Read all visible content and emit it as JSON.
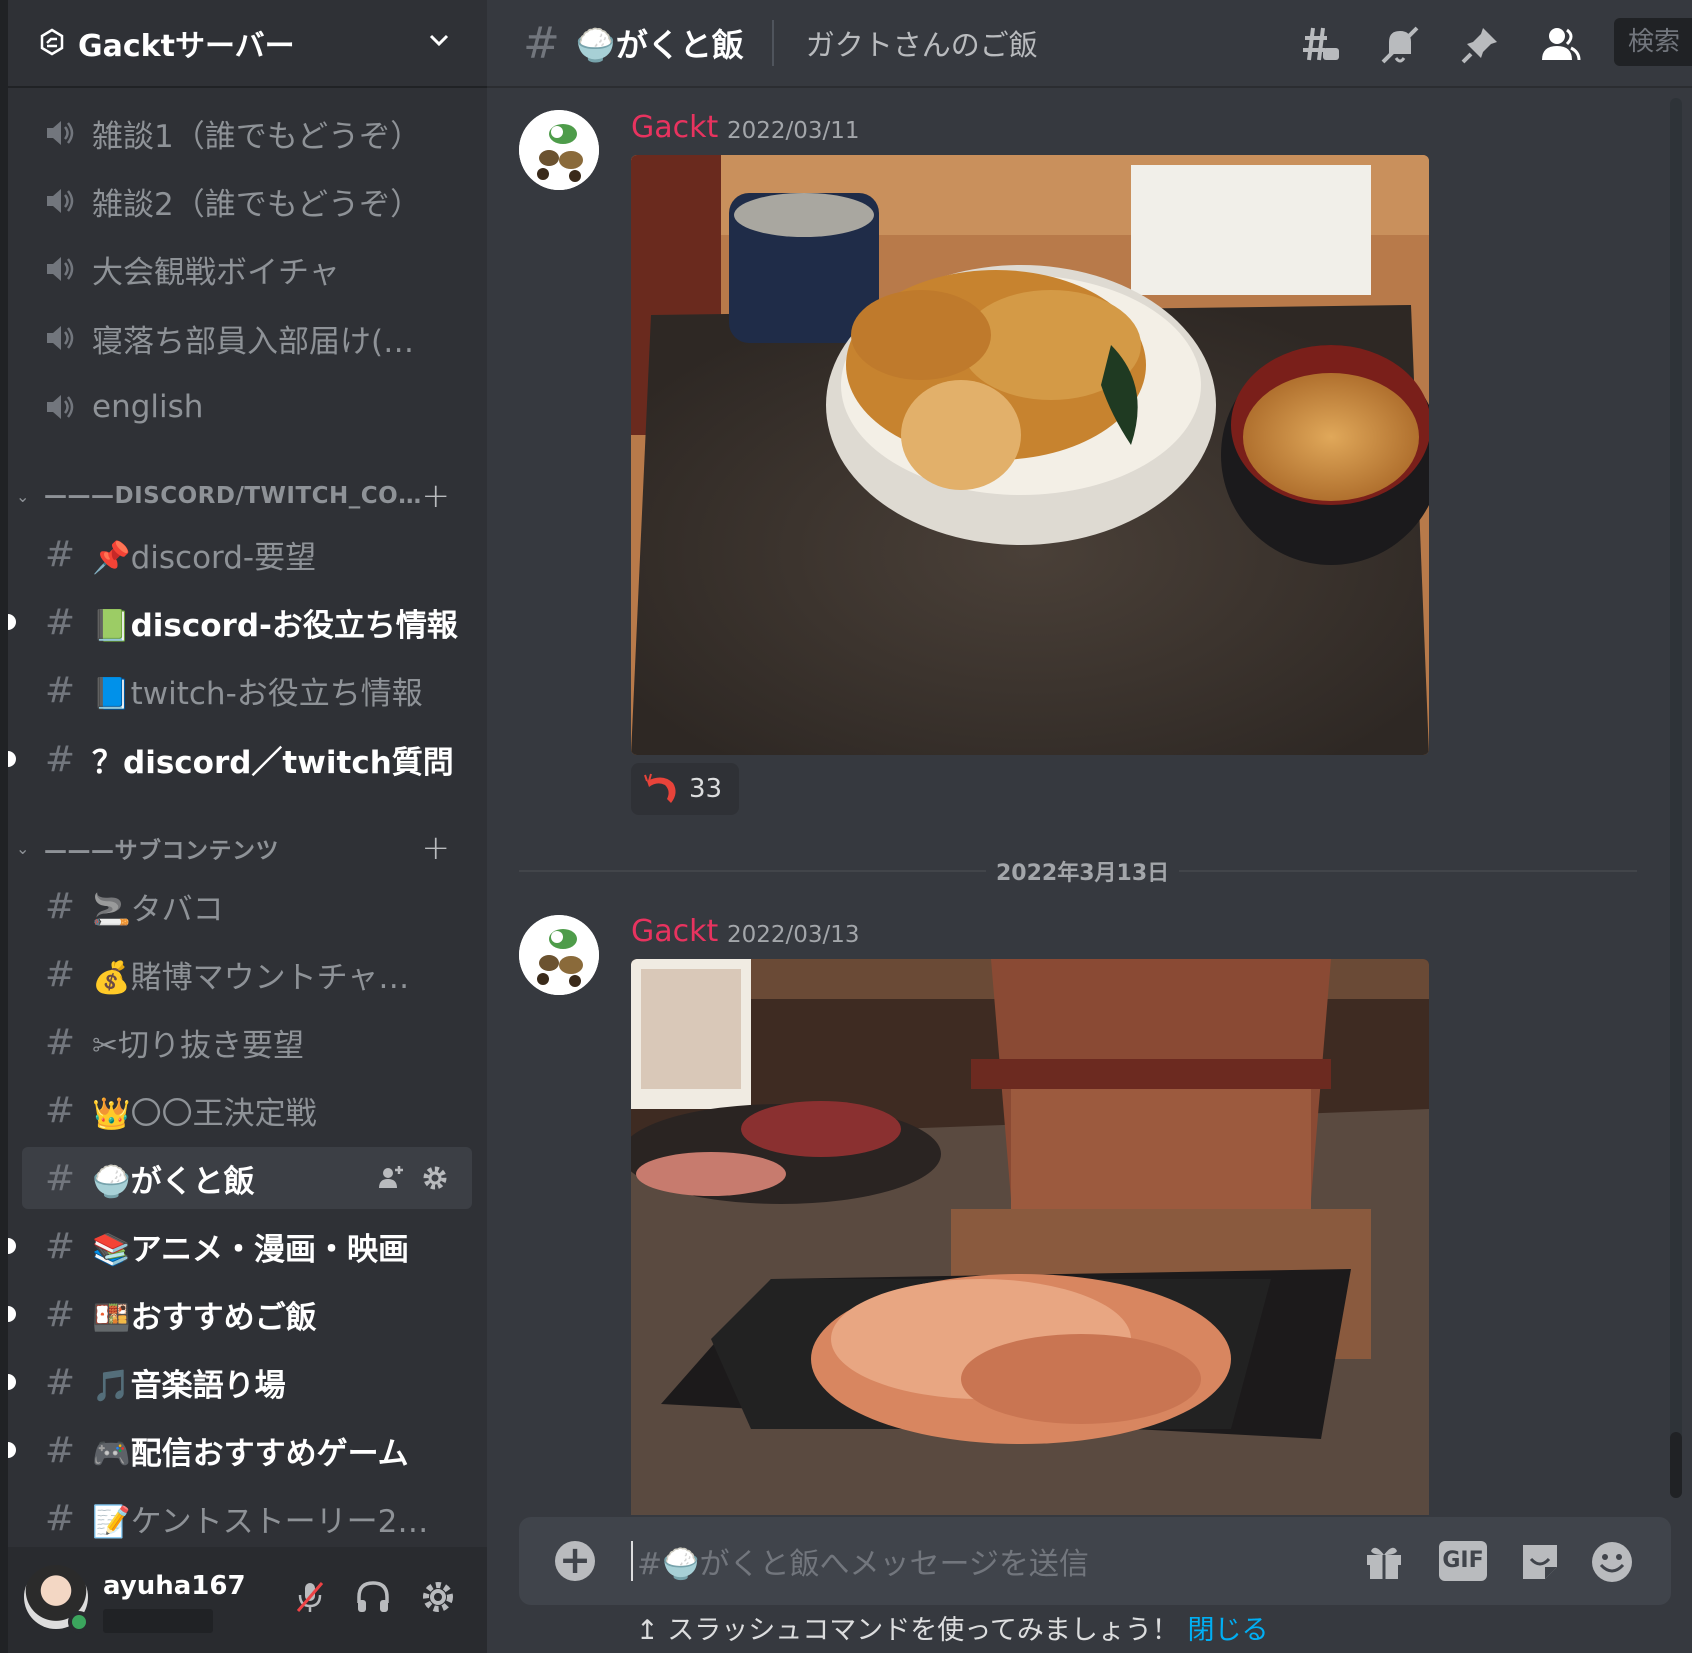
{
  "server": {
    "name": "Gacktサーバー"
  },
  "voice_channels": [
    {
      "name": "雑談1（誰でもどうぞ）"
    },
    {
      "name": "雑談2（誰でもどうぞ）"
    },
    {
      "name": "大会観戦ボイチャ"
    },
    {
      "name": "寝落ち部員入部届け(…"
    },
    {
      "name": "english"
    }
  ],
  "categories": [
    {
      "name": "———DISCORD/TWITCH_CO…",
      "channels": [
        {
          "name": "📌discord-要望",
          "unread": false
        },
        {
          "name": "📗discord-お役立ち情報",
          "unread": true
        },
        {
          "name": "📘twitch-お役立ち情報",
          "unread": false
        },
        {
          "name": "？discord／twitch質問",
          "unread": true
        }
      ]
    },
    {
      "name": "———サブコンテンツ",
      "channels": [
        {
          "name": "🚬タバコ",
          "unread": false
        },
        {
          "name": "💰賭博マウントチャ…",
          "unread": false
        },
        {
          "name": "✂切り抜き要望",
          "unread": false
        },
        {
          "name": "👑〇〇王決定戦",
          "unread": false
        },
        {
          "name": "🍚がくと飯",
          "unread": false,
          "active": true
        },
        {
          "name": "📚アニメ・漫画・映画",
          "unread": true
        },
        {
          "name": "🍱おすすめご飯",
          "unread": true
        },
        {
          "name": "🎵音楽語り場",
          "unread": true
        },
        {
          "name": "🎮配信おすすめゲーム",
          "unread": true
        },
        {
          "name": "📝ケントストーリー2…",
          "unread": false
        }
      ]
    }
  ],
  "user": {
    "name": "ayuha167"
  },
  "topbar": {
    "channel": "🍚がくと飯",
    "topic": "ガクトさんのご飯",
    "search": "検索"
  },
  "messages": [
    {
      "author": "Gackt",
      "timestamp": "2022/03/11",
      "reaction_count": "33"
    },
    {
      "author": "Gackt",
      "timestamp": "2022/03/13"
    }
  ],
  "date_divider": "2022年3月13日",
  "composer": {
    "placeholder": "#🍚がくと飯へメッセージを送信",
    "gif": "GIF"
  },
  "hint": {
    "text": "スラッシュコマンドを使ってみましょう！",
    "close": "閉じる"
  },
  "colors": {
    "accent": "#00aff4",
    "author": "#e8335f",
    "online": "#3ba55d"
  }
}
